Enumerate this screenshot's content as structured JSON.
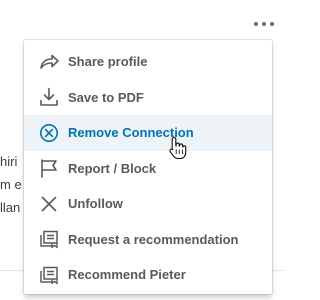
{
  "background": {
    "line1": "hiri",
    "line2": "m e",
    "line3": "llan"
  },
  "menu": {
    "items": [
      {
        "label": "Share profile",
        "icon": "share-arrow-icon"
      },
      {
        "label": "Save to PDF",
        "icon": "download-icon"
      },
      {
        "label": "Remove Connection",
        "icon": "remove-circle-icon",
        "active": true
      },
      {
        "label": "Report / Block",
        "icon": "flag-icon"
      },
      {
        "label": "Unfollow",
        "icon": "close-x-icon"
      },
      {
        "label": "Request a recommendation",
        "icon": "recommendation-icon"
      },
      {
        "label": "Recommend Pieter",
        "icon": "recommendation-icon"
      }
    ]
  },
  "colors": {
    "active_text": "#0073b1",
    "active_bg": "#eef3f8",
    "icon": "#5a5a5a"
  }
}
